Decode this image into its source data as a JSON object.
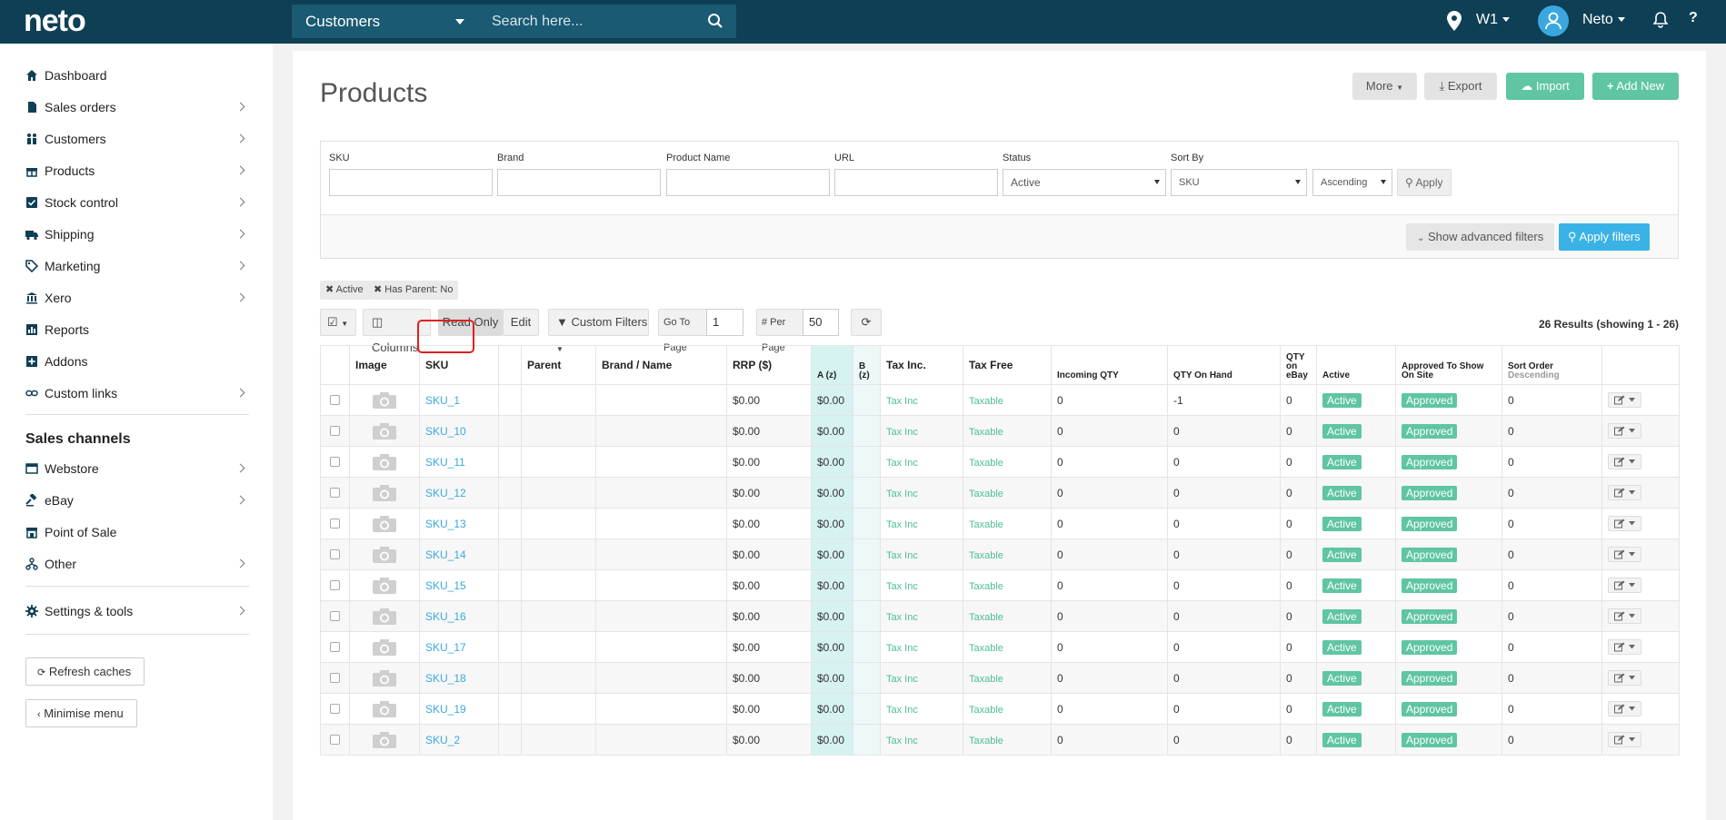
{
  "topbar": {
    "logo": "neto",
    "search_scope": "Customers",
    "search_placeholder": "Search here...",
    "store": "W1",
    "user": "Neto",
    "help": "?"
  },
  "sidebar": {
    "items": [
      {
        "label": "Dashboard",
        "icon": "home-icon"
      },
      {
        "label": "Sales orders",
        "icon": "file-icon"
      },
      {
        "label": "Customers",
        "icon": "users-icon"
      },
      {
        "label": "Products",
        "icon": "gift-icon"
      },
      {
        "label": "Stock control",
        "icon": "check-square-icon"
      },
      {
        "label": "Shipping",
        "icon": "truck-icon"
      },
      {
        "label": "Marketing",
        "icon": "tag-icon"
      },
      {
        "label": "Xero",
        "icon": "bank-icon"
      },
      {
        "label": "Reports",
        "icon": "chart-icon"
      },
      {
        "label": "Addons",
        "icon": "plus-square-icon"
      },
      {
        "label": "Custom links",
        "icon": "link-icon"
      }
    ],
    "channels_heading": "Sales channels",
    "channels": [
      {
        "label": "Webstore",
        "icon": "window-icon"
      },
      {
        "label": "eBay",
        "icon": "gavel-icon"
      },
      {
        "label": "Point of Sale",
        "icon": "store-icon"
      },
      {
        "label": "Other",
        "icon": "sitemap-icon"
      }
    ],
    "settings": "Settings & tools",
    "refresh": "Refresh caches",
    "minimise": "Minimise menu"
  },
  "page": {
    "title": "Products",
    "more": "More",
    "export": "Export",
    "import": "Import",
    "add_new": "Add New"
  },
  "filters": {
    "sku_label": "SKU",
    "brand_label": "Brand",
    "name_label": "Product Name",
    "url_label": "URL",
    "status_label": "Status",
    "status_value": "Active",
    "sortby_label": "Sort By",
    "sortby_value": "SKU",
    "order_value": "Ascending",
    "apply": "Apply",
    "advanced": "Show advanced filters",
    "apply_filters": "Apply filters"
  },
  "chips": [
    "Active",
    "Has Parent: No"
  ],
  "toolbar": {
    "columns": "Columns",
    "read_only": "Read Only",
    "edit": "Edit",
    "custom_filters": "Custom Filters",
    "go_to_page_label": "Go To Page",
    "go_to_page_value": "1",
    "per_page_label": "# Per Page",
    "per_page_value": "50",
    "results": "26 Results (showing 1 - 26)"
  },
  "table": {
    "headers": {
      "image": "Image",
      "sku": "SKU",
      "parent": "Parent",
      "brand": "Brand / Name",
      "rrp": "RRP ($)",
      "a": "A (z)",
      "b": "B (z)",
      "taxinc": "Tax Inc.",
      "taxfree": "Tax Free",
      "incoming": "Incoming QTY",
      "onhand": "QTY On Hand",
      "ebay": "QTY on eBay",
      "active": "Active",
      "approved": "Approved To Show On Site",
      "sort": "Sort Order",
      "sort_sub": "Descending"
    },
    "rows": [
      {
        "sku": "SKU_1",
        "rrp": "$0.00",
        "a": "$0.00",
        "taxinc": "Tax Inc",
        "taxfree": "Taxable",
        "incoming": "0",
        "onhand": "-1",
        "ebay": "0",
        "active": "Active",
        "approved": "Approved",
        "sort": "0"
      },
      {
        "sku": "SKU_10",
        "rrp": "$0.00",
        "a": "$0.00",
        "taxinc": "Tax Inc",
        "taxfree": "Taxable",
        "incoming": "0",
        "onhand": "0",
        "ebay": "0",
        "active": "Active",
        "approved": "Approved",
        "sort": "0"
      },
      {
        "sku": "SKU_11",
        "rrp": "$0.00",
        "a": "$0.00",
        "taxinc": "Tax Inc",
        "taxfree": "Taxable",
        "incoming": "0",
        "onhand": "0",
        "ebay": "0",
        "active": "Active",
        "approved": "Approved",
        "sort": "0"
      },
      {
        "sku": "SKU_12",
        "rrp": "$0.00",
        "a": "$0.00",
        "taxinc": "Tax Inc",
        "taxfree": "Taxable",
        "incoming": "0",
        "onhand": "0",
        "ebay": "0",
        "active": "Active",
        "approved": "Approved",
        "sort": "0"
      },
      {
        "sku": "SKU_13",
        "rrp": "$0.00",
        "a": "$0.00",
        "taxinc": "Tax Inc",
        "taxfree": "Taxable",
        "incoming": "0",
        "onhand": "0",
        "ebay": "0",
        "active": "Active",
        "approved": "Approved",
        "sort": "0"
      },
      {
        "sku": "SKU_14",
        "rrp": "$0.00",
        "a": "$0.00",
        "taxinc": "Tax Inc",
        "taxfree": "Taxable",
        "incoming": "0",
        "onhand": "0",
        "ebay": "0",
        "active": "Active",
        "approved": "Approved",
        "sort": "0"
      },
      {
        "sku": "SKU_15",
        "rrp": "$0.00",
        "a": "$0.00",
        "taxinc": "Tax Inc",
        "taxfree": "Taxable",
        "incoming": "0",
        "onhand": "0",
        "ebay": "0",
        "active": "Active",
        "approved": "Approved",
        "sort": "0"
      },
      {
        "sku": "SKU_16",
        "rrp": "$0.00",
        "a": "$0.00",
        "taxinc": "Tax Inc",
        "taxfree": "Taxable",
        "incoming": "0",
        "onhand": "0",
        "ebay": "0",
        "active": "Active",
        "approved": "Approved",
        "sort": "0"
      },
      {
        "sku": "SKU_17",
        "rrp": "$0.00",
        "a": "$0.00",
        "taxinc": "Tax Inc",
        "taxfree": "Taxable",
        "incoming": "0",
        "onhand": "0",
        "ebay": "0",
        "active": "Active",
        "approved": "Approved",
        "sort": "0"
      },
      {
        "sku": "SKU_18",
        "rrp": "$0.00",
        "a": "$0.00",
        "taxinc": "Tax Inc",
        "taxfree": "Taxable",
        "incoming": "0",
        "onhand": "0",
        "ebay": "0",
        "active": "Active",
        "approved": "Approved",
        "sort": "0"
      },
      {
        "sku": "SKU_19",
        "rrp": "$0.00",
        "a": "$0.00",
        "taxinc": "Tax Inc",
        "taxfree": "Taxable",
        "incoming": "0",
        "onhand": "0",
        "ebay": "0",
        "active": "Active",
        "approved": "Approved",
        "sort": "0"
      },
      {
        "sku": "SKU_2",
        "rrp": "$0.00",
        "a": "$0.00",
        "taxinc": "Tax Inc",
        "taxfree": "Taxable",
        "incoming": "0",
        "onhand": "0",
        "ebay": "0",
        "active": "Active",
        "approved": "Approved",
        "sort": "0"
      }
    ]
  },
  "colors": {
    "topbar": "#0e3f55",
    "accent_green": "#5fc5a3",
    "link_blue": "#3aa8df",
    "apply_blue": "#3bb2e6"
  }
}
